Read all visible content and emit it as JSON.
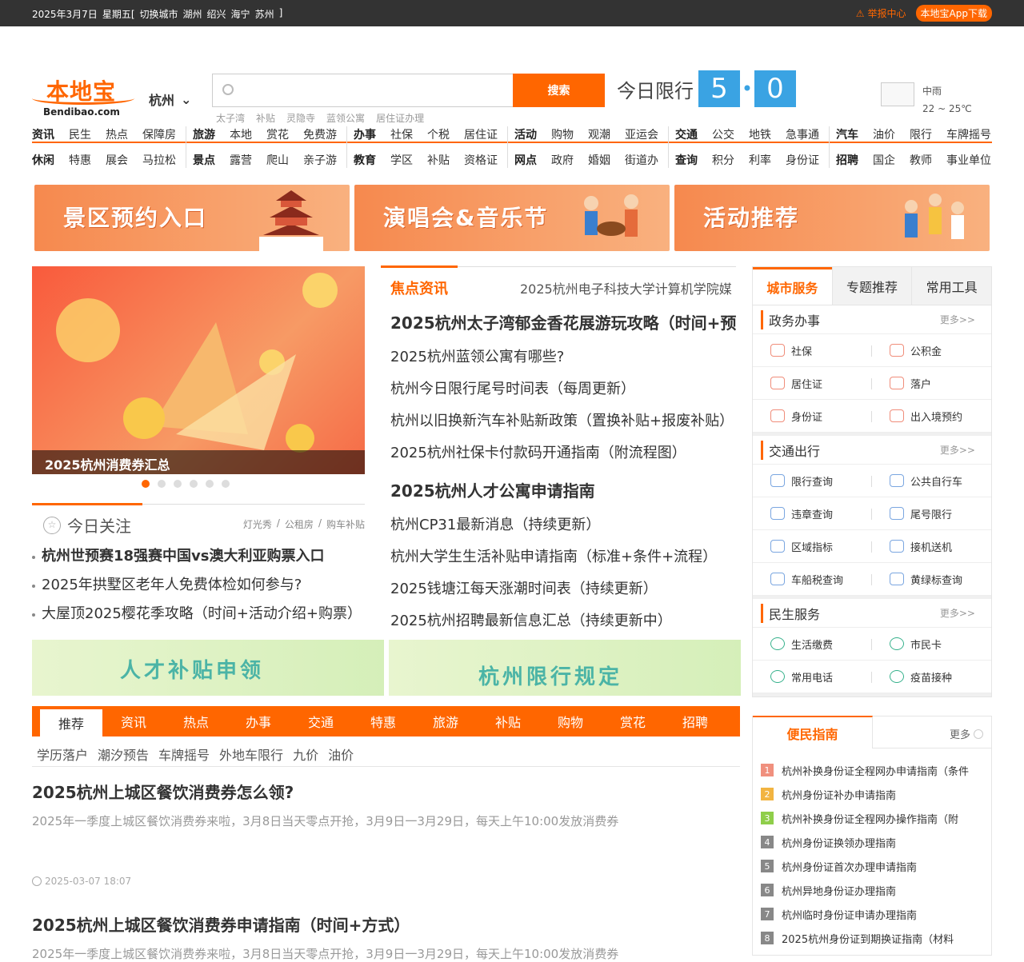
{
  "topbar": {
    "date": "2025年3月7日",
    "weekday": "星期五[",
    "switch": "切换城市",
    "cities": [
      "湖州",
      "绍兴",
      "海宁",
      "苏州"
    ],
    "close": "]",
    "report": "举报中心",
    "app": "本地宝App下载"
  },
  "logo": {
    "cn": "本地宝",
    "en": "Bendibao.com"
  },
  "city": "杭州",
  "search": {
    "placeholder": "",
    "button": "搜索",
    "hot": [
      "太子湾",
      "补贴",
      "灵隐寺",
      "蓝领公寓",
      "居住证办理"
    ]
  },
  "limit": {
    "label": "今日限行",
    "n1": "5",
    "sep": "•",
    "n2": "0"
  },
  "weather": {
    "cond": "中雨",
    "temp": "22 ~ 25℃"
  },
  "nav": [
    {
      "r1": [
        "资讯",
        "民生",
        "热点",
        "保障房"
      ],
      "r2": [
        "休闲",
        "特惠",
        "展会",
        "马拉松"
      ]
    },
    {
      "r1": [
        "旅游",
        "本地",
        "赏花",
        "免费游"
      ],
      "r2": [
        "景点",
        "露营",
        "爬山",
        "亲子游"
      ]
    },
    {
      "r1": [
        "办事",
        "社保",
        "个税",
        "居住证"
      ],
      "r2": [
        "教育",
        "学区",
        "补贴",
        "资格证"
      ]
    },
    {
      "r1": [
        "活动",
        "购物",
        "观潮",
        "亚运会"
      ],
      "r2": [
        "网点",
        "政府",
        "婚姻",
        "街道办"
      ]
    },
    {
      "r1": [
        "交通",
        "公交",
        "地铁",
        "急事通"
      ],
      "r2": [
        "查询",
        "积分",
        "利率",
        "身份证"
      ]
    },
    {
      "r1": [
        "汽车",
        "油价",
        "限行",
        "车牌摇号"
      ],
      "r2": [
        "招聘",
        "国企",
        "教师",
        "事业单位"
      ]
    }
  ],
  "banners": [
    "景区预约入口",
    "演唱会&音乐节",
    "活动推荐"
  ],
  "slider": {
    "caption": "2025杭州消费券汇总"
  },
  "attention": {
    "title": "今日关注",
    "links": [
      "灯光秀",
      "/",
      "公租房",
      "/",
      "购车补贴"
    ],
    "items": [
      "杭州世预赛18强赛中国vs澳大利亚购票入口",
      "2025年拱墅区老年人免费体检如何参与?",
      "大屋顶2025樱花季攻略（时间+活动介绍+购票）"
    ]
  },
  "focus": {
    "title": "焦点资讯",
    "marquee": "2025杭州电子科技大学计算机学院媒",
    "h1": "2025杭州太子湾郁金香花展游玩攻略（时间+预",
    "g1": [
      "2025杭州蓝领公寓有哪些?",
      "杭州今日限行尾号时间表（每周更新）",
      "杭州以旧换新汽车补贴新政策（置换补贴+报废补贴）",
      "2025杭州社保卡付款码开通指南（附流程图）"
    ],
    "h2": "2025杭州人才公寓申请指南",
    "g2": [
      "杭州CP31最新消息（持续更新）",
      "杭州大学生生活补贴申请指南（标准+条件+流程）",
      "2025钱塘江每天涨潮时间表（持续更新）",
      "2025杭州招聘最新信息汇总（持续更新中）"
    ]
  },
  "ads": [
    "人才补贴申领",
    "杭州限行规定"
  ],
  "tabs": [
    "推荐",
    "资讯",
    "热点",
    "办事",
    "交通",
    "特惠",
    "旅游",
    "补贴",
    "购物",
    "赏花",
    "招聘"
  ],
  "subtabs": [
    "学历落户",
    "潮汐预告",
    "车牌摇号",
    "外地车限行",
    "九价",
    "油价"
  ],
  "news": [
    {
      "t": "2025杭州上城区餐饮消费券怎么领?",
      "d": "2025年一季度上城区餐饮消费券来啦，3月8日当天零点开抢，3月9日一3月29日，每天上午10:00发放消费券",
      "tm": "2025-03-07 18:07"
    },
    {
      "t": "2025杭州上城区餐饮消费券申请指南（时间+方式）",
      "d": "2025年一季度上城区餐饮消费券来啦，3月8日当天零点开抢，3月9日一3月29日，每天上午10:00发放消费券"
    }
  ],
  "side": {
    "tabs": [
      "城市服务",
      "专题推荐",
      "常用工具"
    ],
    "more": "更多>>",
    "secs": [
      {
        "name": "政务办事",
        "items": [
          "社保",
          "公积金",
          "居住证",
          "落户",
          "身份证",
          "出入境预约"
        ]
      },
      {
        "name": "交通出行",
        "items": [
          "限行查询",
          "公共自行车",
          "违章查询",
          "尾号限行",
          "区域指标",
          "接机送机",
          "车船税查询",
          "黄绿标查询"
        ]
      },
      {
        "name": "民生服务",
        "items": [
          "生活缴费",
          "市民卡",
          "常用电话",
          "疫苗接种"
        ]
      }
    ]
  },
  "guide": {
    "title": "便民指南",
    "more": "更多",
    "items": [
      "杭州补换身份证全程网办申请指南（条件",
      "杭州身份证补办申请指南",
      "杭州补换身份证全程网办操作指南（附",
      "杭州身份证换领办理指南",
      "杭州身份证首次办理申请指南",
      "杭州异地身份证办理指南",
      "杭州临时身份证申请办理指南",
      "2025杭州身份证到期换证指南（材料"
    ],
    "colors": [
      "#f0907e",
      "#f2b441",
      "#8fce4a",
      "#888",
      "#888",
      "#888",
      "#888",
      "#888"
    ]
  }
}
